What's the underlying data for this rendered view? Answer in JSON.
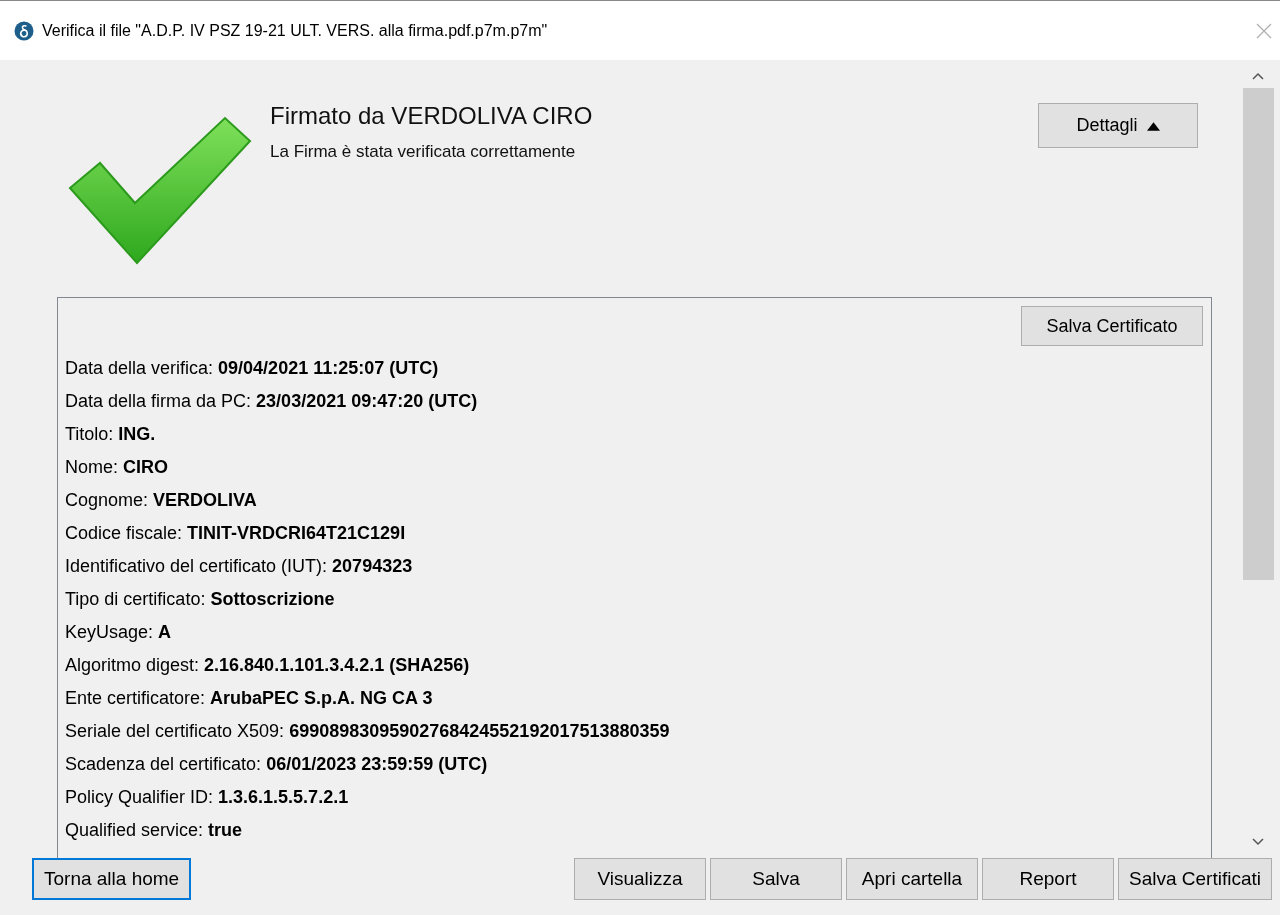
{
  "window": {
    "title": "Verifica il file \"A.D.P. IV PSZ 19-21 ULT. VERS. alla firma.pdf.p7m.p7m\""
  },
  "result": {
    "heading": "Firmato da VERDOLIVA CIRO",
    "message": "La Firma è stata verificata correttamente"
  },
  "details_button": {
    "label": "Dettagli",
    "expanded": true
  },
  "details": {
    "save_button": "Salva Certificato",
    "lines": [
      "Data della verifica: **09/04/2021 11:25:07 (UTC)**",
      "Data della firma da PC: **23/03/2021 09:47:20 (UTC)**",
      "Titolo: **ING.**",
      "Nome: **CIRO**",
      "Cognome: **VERDOLIVA**",
      "Codice fiscale: **TINIT-VRDCRI64T21C129I**",
      "Identificativo del certificato (IUT): **20794323**",
      "Tipo di certificato: **Sottoscrizione**",
      "KeyUsage: **A**",
      "Algoritmo digest: **2.16.840.1.101.3.4.2.1 (SHA256)**",
      "Ente certificatore: **ArubaPEC S.p.A. NG CA 3**",
      "Seriale del certificato X509: **69908983095902768424552192017513880359**",
      "Scadenza del certificato: **06/01/2023 23:59:59 (UTC)**",
      "Policy Qualifier ID: **1.3.6.1.5.5.7.2.1**",
      "Qualified service: **true**"
    ]
  },
  "home_button": {
    "label": "Torna alla home",
    "focused": true
  },
  "buttons": [
    {
      "label": "Visualizza",
      "focused": false
    },
    {
      "label": "Salva",
      "focused": false
    },
    {
      "label": "Apri cartella",
      "focused": false
    },
    {
      "label": "Report",
      "focused": false
    },
    {
      "label": "Salva Certificati",
      "focused": false
    }
  ]
}
